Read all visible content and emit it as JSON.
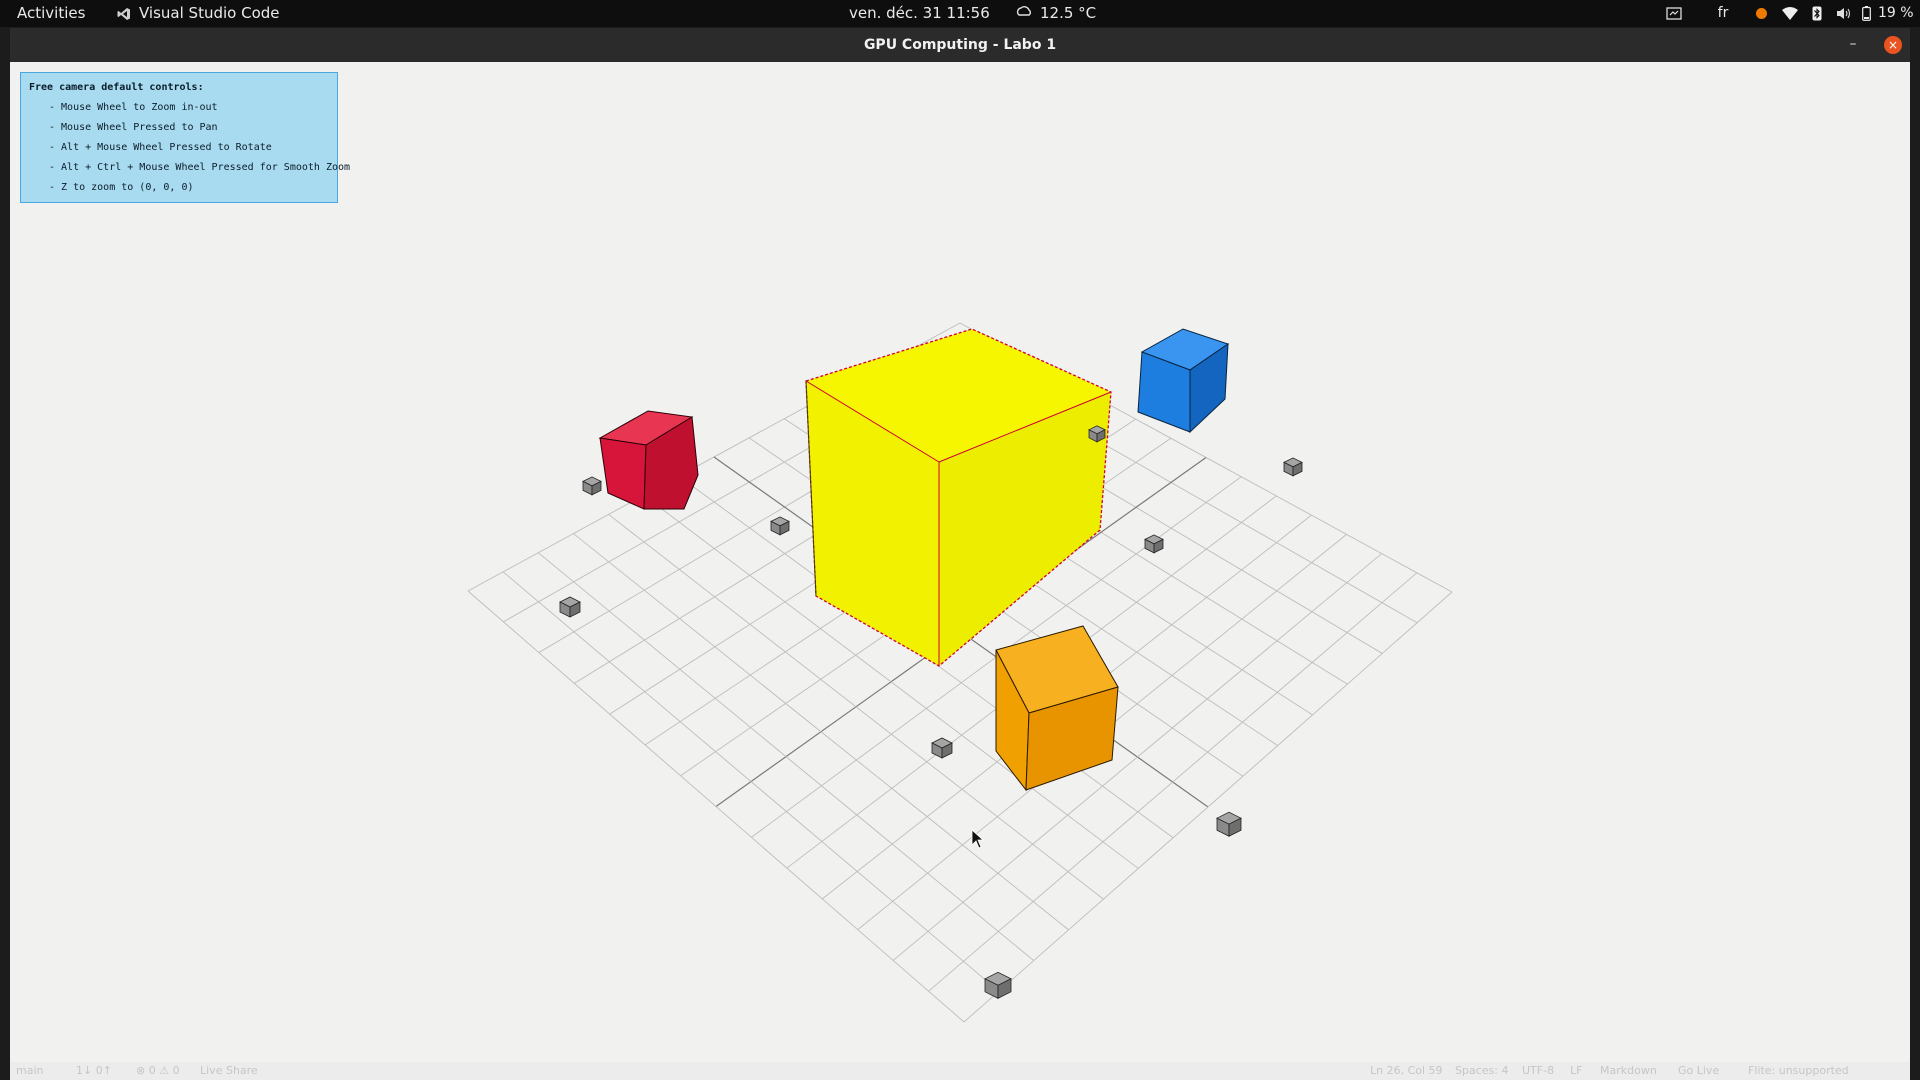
{
  "topbar": {
    "activities": "Activities",
    "app_name": "Visual Studio Code",
    "clock": "ven. déc. 31  11:56",
    "weather": "12.5 °C",
    "keyboard_layout": "fr",
    "battery": "19 %"
  },
  "window": {
    "title": "GPU Computing - Labo 1",
    "minimize_label": "–",
    "close_label": "×"
  },
  "help_panel": {
    "title": "Free camera default controls:",
    "lines": [
      "- Mouse Wheel to Zoom in-out",
      "- Mouse Wheel Pressed to Pan",
      "- Alt + Mouse Wheel Pressed to Rotate",
      "- Alt + Ctrl + Mouse Wheel Pressed for Smooth Zoom",
      "- Z to zoom to (0, 0, 0)"
    ]
  },
  "scene": {
    "colors": {
      "grid": "#bdbdbd",
      "grid_axis": "#7a7a7a",
      "yellow_cube": "#f4f400",
      "red_cube": "#d91a3a",
      "blue_cube": "#1e7ee0",
      "orange_cube": "#f0a000",
      "small_cube": "#8a8a8a",
      "yellow_edge": "#d0003a"
    },
    "objects": [
      {
        "name": "yellow-cube",
        "kind": "large cube"
      },
      {
        "name": "red-cube",
        "kind": "cube"
      },
      {
        "name": "blue-cube",
        "kind": "cube"
      },
      {
        "name": "orange-cube",
        "kind": "cube"
      },
      {
        "name": "small-gray-cube",
        "kind": "small cube",
        "count": 10
      }
    ]
  },
  "statusbar": {
    "branch": "main",
    "sync": "1↓ 0↑",
    "problems": "⊗ 0 ⚠ 0",
    "live_share": "Live Share",
    "cursor_position": "Ln 26, Col 59",
    "indent": "Spaces: 4",
    "encoding": "UTF-8",
    "eol": "LF",
    "language": "Markdown",
    "go_live": "Go Live",
    "prettier": "Flite: unsupported"
  }
}
